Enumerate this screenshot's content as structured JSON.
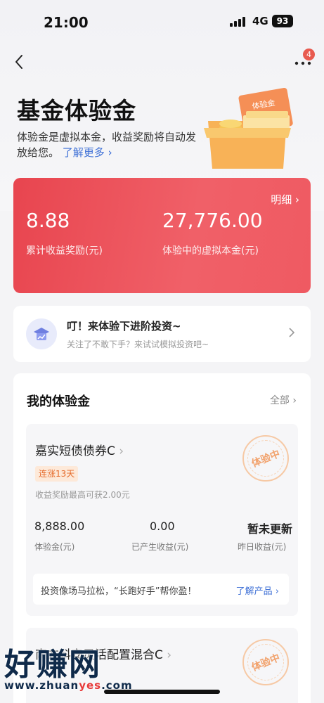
{
  "status_bar": {
    "time": "21:00",
    "network": "4G",
    "battery": "93"
  },
  "nav": {
    "badge": "4",
    "back_icon": "chevron-left-icon",
    "more_icon": "more-dots-icon"
  },
  "header": {
    "title": "基金体验金",
    "desc": "体验金是虚拟本金，收益奖励将自动发放给您。",
    "more_link": "了解更多",
    "illustration_text": "体验金"
  },
  "summary": {
    "detail_label": "明细",
    "reward_value": "8.88",
    "reward_label": "累计收益奖励(元)",
    "principal_value": "27,776.00",
    "principal_label": "体验中的虚拟本金(元)",
    "card_color": "#e8454f"
  },
  "promo": {
    "title": "叮！来体验下进阶投资~",
    "subtitle": "关注了不敢下手？来试试模拟投资吧~",
    "icon": "graduation-cap-chart-icon"
  },
  "my_section": {
    "title": "我的体验金",
    "all_label": "全部",
    "funds": [
      {
        "name": "嘉实短债债券C",
        "tag": "连涨13天",
        "note": "收益奖励最高可获2.00元",
        "stamp": "体验中",
        "stats": [
          {
            "value": "8,888.00",
            "label": "体验金(元)"
          },
          {
            "value": "0.00",
            "label": "已产生收益(元)"
          },
          {
            "value": "暂未更新",
            "label": "昨日收益(元)"
          }
        ],
        "bar_text": "投资像场马拉松，“长跑好手”帮你盈！",
        "bar_link": "了解产品"
      },
      {
        "name": "南方科安灵活配置混合C",
        "stamp": "体验中"
      }
    ]
  },
  "watermark": {
    "brand": "好赚网",
    "url_a": "www.zhuan",
    "url_b": "yes",
    "url_c": ".com"
  }
}
